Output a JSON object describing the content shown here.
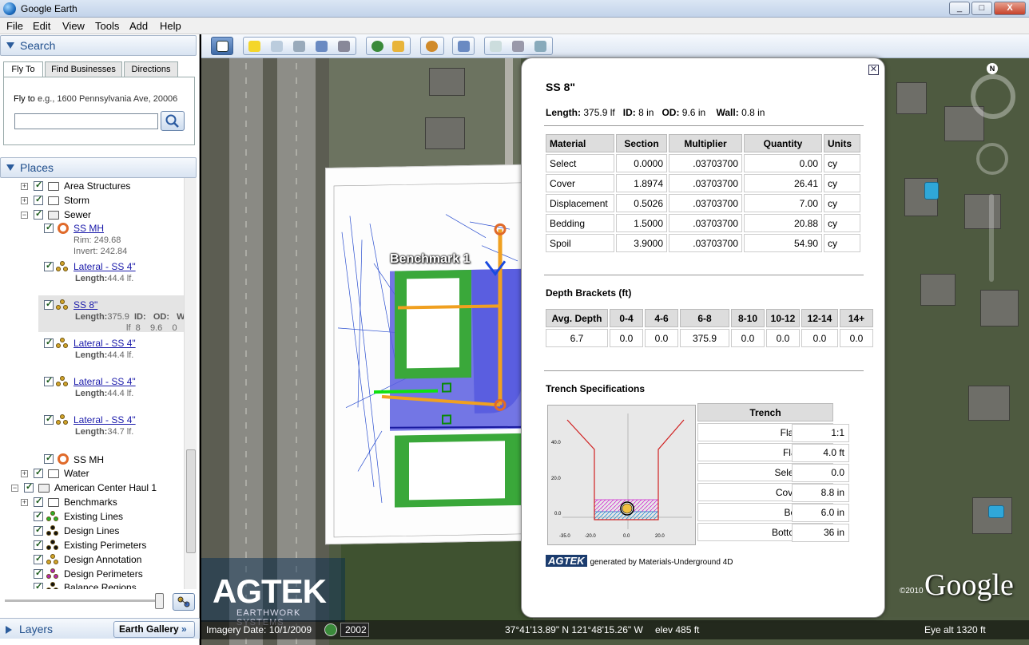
{
  "window": {
    "title": "Google Earth",
    "min": "_",
    "max": "□",
    "close": "X"
  },
  "menu": [
    "File",
    "Edit",
    "View",
    "Tools",
    "Add",
    "Help"
  ],
  "search": {
    "header": "Search",
    "tabs": [
      "Fly To",
      "Find Businesses",
      "Directions"
    ],
    "fly_label": "Fly to",
    "fly_hint": "e.g., 1600 Pennsylvania Ave, 20006",
    "fly_value": ""
  },
  "places": {
    "header": "Places",
    "items": [
      {
        "label": "Area Structures"
      },
      {
        "label": "Storm"
      },
      {
        "label": "Sewer"
      },
      {
        "label": "SS MH",
        "rim": "Rim: 249.68",
        "invert": "Invert: 242.84"
      },
      {
        "label": "Lateral - SS 4\"",
        "length_key": "Length:",
        "length": "44.4 lf."
      },
      {
        "label": "SS 8\"",
        "length_key": "Length:",
        "length": "375.9",
        "id_key": "ID:",
        "od_key": "OD:",
        "w_key": "W",
        "unit": "lf",
        "id_val": "8",
        "od_val": "9.6",
        "w_val": "0"
      },
      {
        "label": "Lateral - SS 4\"",
        "length_key": "Length:",
        "length": "44.4 lf."
      },
      {
        "label": "Lateral - SS 4\"",
        "length_key": "Length:",
        "length": "44.4 lf."
      },
      {
        "label": "Lateral - SS 4\"",
        "length_key": "Length:",
        "length": "34.7 lf."
      },
      {
        "label": "SS MH"
      },
      {
        "label": "Water"
      },
      {
        "label": "American Center Haul 1"
      },
      {
        "label": "Benchmarks"
      },
      {
        "label": "Existing Lines"
      },
      {
        "label": "Design Lines"
      },
      {
        "label": "Existing Perimeters"
      },
      {
        "label": "Design Annotation"
      },
      {
        "label": "Design Perimeters"
      },
      {
        "label": "Balance Regions"
      }
    ]
  },
  "layers": {
    "header": "Layers",
    "gallery": "Earth Gallery",
    "gallery_arrows": "»"
  },
  "map": {
    "benchmark": "Benchmark 1",
    "watermark_big": "AGTEK",
    "watermark_small": "EARTHWORK SYSTEMS",
    "google": "Google",
    "copyright": "©2010",
    "compass_n": "N",
    "status": {
      "imagery": "Imagery Date: 10/1/2009",
      "year": "2002",
      "coords": "37°41'13.89\" N 121°48'15.26\" W",
      "elev": "elev   485 ft",
      "eye": "Eye alt   1320 ft"
    }
  },
  "balloon": {
    "close": "✕",
    "title": "SS 8\"",
    "summary": {
      "length_key": "Length:",
      "length": "375.9 lf",
      "id_key": "ID:",
      "id": "8 in",
      "od_key": "OD:",
      "od": "9.6 in",
      "wall_key": "Wall:",
      "wall": "0.8 in"
    },
    "materials": {
      "headers": [
        "Material",
        "Section",
        "Multiplier",
        "Quantity",
        "Units"
      ],
      "rows": [
        [
          "Select",
          "0.0000",
          ".03703700",
          "0.00",
          "cy"
        ],
        [
          "Cover",
          "1.8974",
          ".03703700",
          "26.41",
          "cy"
        ],
        [
          "Displacement",
          "0.5026",
          ".03703700",
          "7.00",
          "cy"
        ],
        [
          "Bedding",
          "1.5000",
          ".03703700",
          "20.88",
          "cy"
        ],
        [
          "Spoil",
          "3.9000",
          ".03703700",
          "54.90",
          "cy"
        ]
      ]
    },
    "depth": {
      "title": "Depth Brackets (ft)",
      "headers": [
        "Avg. Depth",
        "0-4",
        "4-6",
        "6-8",
        "8-10",
        "10-12",
        "12-14",
        "14+"
      ],
      "values": [
        "6.7",
        "0.0",
        "0.0",
        "375.9",
        "0.0",
        "0.0",
        "0.0",
        "0.0"
      ]
    },
    "trench": {
      "title": "Trench Specifications",
      "header": "Trench",
      "rows": [
        [
          "Flare Slope",
          "1:1"
        ],
        [
          "Flare Point",
          "4.0 ft"
        ],
        [
          "Select Thick.",
          "0.0"
        ],
        [
          "Cover Thick.",
          "8.8 in"
        ],
        [
          "Bed Thick.",
          "6.0 in"
        ],
        [
          "Bottom Width",
          "36 in"
        ]
      ],
      "diagram": {
        "y_ticks": [
          "40.0",
          "20.0",
          "0.0"
        ],
        "x_ticks": [
          "-35.0",
          "-20.0",
          "0.0",
          "20.0"
        ]
      }
    },
    "footer": {
      "brand": "AGTEK",
      "text": "generated by Materials-Underground 4D"
    }
  }
}
